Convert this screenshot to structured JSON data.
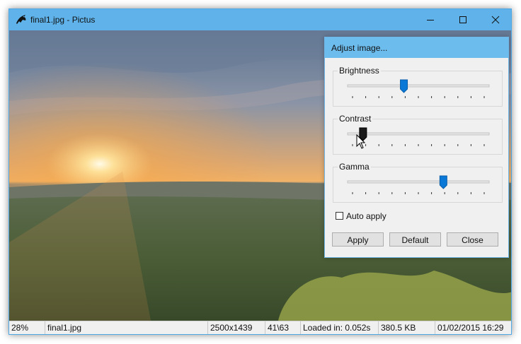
{
  "window": {
    "title": "final1.jpg - Pictus",
    "accent_color": "#5fb3ea",
    "controls": [
      "minimize-icon",
      "maximize-icon",
      "close-icon"
    ]
  },
  "dialog": {
    "title": "Adjust image...",
    "sliders": [
      {
        "label": "Brightness",
        "level": 0.39,
        "ticks": 11
      },
      {
        "label": "Contrast",
        "level": 0.08,
        "ticks": 11
      },
      {
        "label": "Gamma",
        "level": 0.69,
        "ticks": 11
      }
    ],
    "auto_apply": {
      "label": "Auto apply",
      "checked": false
    },
    "buttons": {
      "apply": "Apply",
      "default": "Default",
      "close": "Close"
    }
  },
  "status": {
    "zoom": "28%",
    "filename": "final1.jpg",
    "dimensions": "2500x1439",
    "position": "41\\63",
    "load_time": "Loaded in: 0.052s",
    "size": "380.5 KB",
    "date": "01/02/2015 16:29"
  }
}
